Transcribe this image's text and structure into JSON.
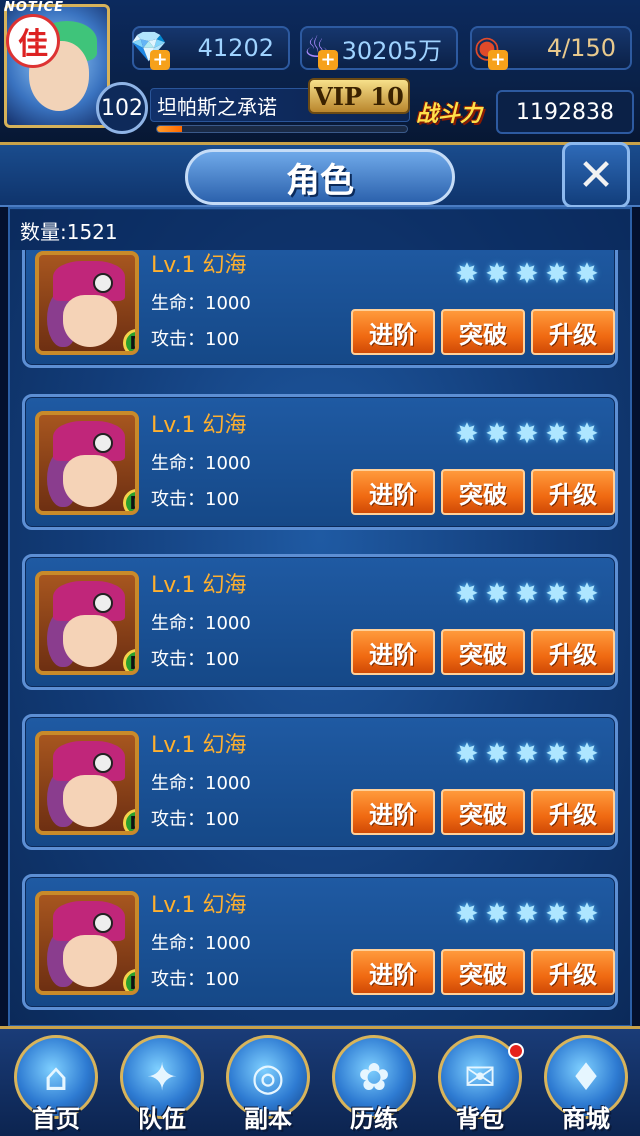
{
  "header": {
    "notice": "NOTICE",
    "badge": "佳",
    "resources": [
      {
        "name": "gems",
        "icon": "diamond-icon",
        "value": "41202"
      },
      {
        "name": "spirit",
        "icon": "purple-flame-icon",
        "value": "30205万"
      },
      {
        "name": "stamina",
        "icon": "food-bowl-icon",
        "value": "4/150"
      }
    ],
    "level": "102",
    "player_name": "坦帕斯之承诺",
    "exp_fraction": 0.1,
    "vip": "VIP 10",
    "power_label": "战斗力",
    "power_value": "1192838"
  },
  "page": {
    "title": "角色",
    "count_label": "数量:1521"
  },
  "cards": [
    {
      "name": "Lv.1 幻海",
      "hp": "生命：1000",
      "atk": "攻击：100",
      "rank": "D",
      "stars": 5
    },
    {
      "name": "Lv.1 幻海",
      "hp": "生命：1000",
      "atk": "攻击：100",
      "rank": "D",
      "stars": 5
    },
    {
      "name": "Lv.1 幻海",
      "hp": "生命：1000",
      "atk": "攻击：100",
      "rank": "D",
      "stars": 5
    },
    {
      "name": "Lv.1 幻海",
      "hp": "生命：1000",
      "atk": "攻击：100",
      "rank": "D",
      "stars": 5
    },
    {
      "name": "Lv.1 幻海",
      "hp": "生命：1000",
      "atk": "攻击：100",
      "rank": "D",
      "stars": 5
    }
  ],
  "card_buttons": {
    "advance": "进阶",
    "breakthrough": "突破",
    "upgrade": "升级"
  },
  "nav": [
    {
      "label": "首页",
      "icon": "home-icon",
      "glyph": "⌂"
    },
    {
      "label": "队伍",
      "icon": "team-icon",
      "glyph": "✦"
    },
    {
      "label": "副本",
      "icon": "dungeon-icon",
      "glyph": "◎"
    },
    {
      "label": "历练",
      "icon": "training-icon",
      "glyph": "✿"
    },
    {
      "label": "背包",
      "icon": "bag-icon",
      "glyph": "✉",
      "notify": true
    },
    {
      "label": "商城",
      "icon": "shop-icon",
      "glyph": "♦"
    }
  ],
  "colors": {
    "accent_gold": "#c9a24a",
    "button_orange": "#f06a12",
    "hero_name": "#ffb02e"
  }
}
